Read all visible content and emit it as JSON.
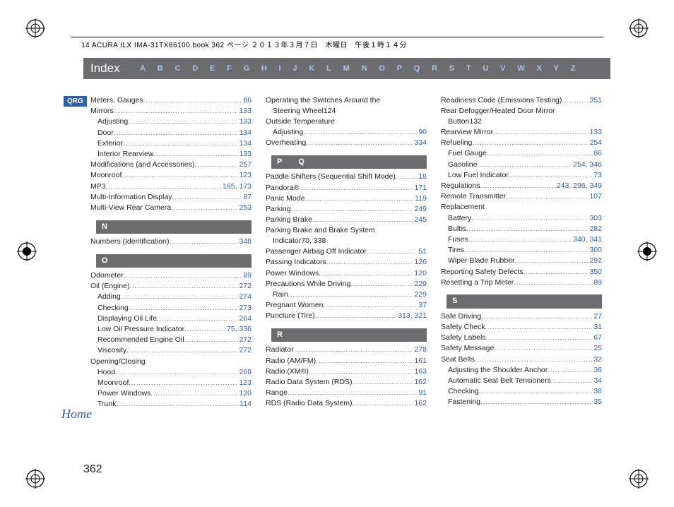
{
  "header": "14 ACURA ILX IMA-31TX86100.book  362 ページ  ２０１３年３月７日　木曜日　午後１時１４分",
  "qrg": "QRG",
  "home": "Home",
  "title": "Index",
  "alphabet": [
    "A",
    "B",
    "C",
    "D",
    "E",
    "F",
    "G",
    "H",
    "I",
    "J",
    "K",
    "L",
    "M",
    "N",
    "O",
    "P",
    "Q",
    "R",
    "S",
    "T",
    "U",
    "V",
    "W",
    "X",
    "Y",
    "Z"
  ],
  "page_number": "362",
  "columns": [
    {
      "items": [
        {
          "type": "entry",
          "label": "Meters, Gauges",
          "pages": "86"
        },
        {
          "type": "entry",
          "label": "Mirrors",
          "pages": "133"
        },
        {
          "type": "entry",
          "sub": true,
          "label": "Adjusting",
          "pages": "133"
        },
        {
          "type": "entry",
          "sub": true,
          "label": "Door",
          "pages": "134"
        },
        {
          "type": "entry",
          "sub": true,
          "label": "Exterior",
          "pages": "134"
        },
        {
          "type": "entry",
          "sub": true,
          "label": "Interior Rearview",
          "pages": "133"
        },
        {
          "type": "entry",
          "label": "Modifications (and Accessories)",
          "pages": "257"
        },
        {
          "type": "entry",
          "label": "Moonroof",
          "pages": "123"
        },
        {
          "type": "entry",
          "label": "MP3",
          "pages": "165, 173"
        },
        {
          "type": "entry",
          "label": "Multi-Information Display",
          "pages": "87"
        },
        {
          "type": "entry",
          "label": "Multi-View Rear Camera",
          "pages": "253"
        },
        {
          "type": "section",
          "label": "N"
        },
        {
          "type": "entry",
          "label": "Numbers (Identification)",
          "pages": "348"
        },
        {
          "type": "section",
          "label": "O"
        },
        {
          "type": "entry",
          "label": "Odometer",
          "pages": "89"
        },
        {
          "type": "entry",
          "label": "Oil (Engine)",
          "pages": "272"
        },
        {
          "type": "entry",
          "sub": true,
          "label": "Adding",
          "pages": "274"
        },
        {
          "type": "entry",
          "sub": true,
          "label": "Checking",
          "pages": "273"
        },
        {
          "type": "entry",
          "sub": true,
          "label": "Displaying Oil Life",
          "pages": "264"
        },
        {
          "type": "entry",
          "sub": true,
          "label": "Low Oil Pressure Indicator",
          "pages": "75, 336"
        },
        {
          "type": "entry",
          "sub": true,
          "label": "Recommended Engine Oil",
          "pages": "272"
        },
        {
          "type": "entry",
          "sub": true,
          "label": "Viscosity",
          "pages": "272"
        },
        {
          "type": "plain",
          "label": "Opening/Closing"
        },
        {
          "type": "entry",
          "sub": true,
          "label": "Hood",
          "pages": "269"
        },
        {
          "type": "entry",
          "sub": true,
          "label": "Moonroof",
          "pages": "123"
        },
        {
          "type": "entry",
          "sub": true,
          "label": "Power Windows",
          "pages": "120"
        },
        {
          "type": "entry",
          "sub": true,
          "label": "Trunk",
          "pages": "114"
        }
      ]
    },
    {
      "items": [
        {
          "type": "multiline",
          "first": "Operating the Switches Around the",
          "cont": "Steering Wheel",
          "pages": "124"
        },
        {
          "type": "plain",
          "label": "Outside Temperature"
        },
        {
          "type": "entry",
          "sub": true,
          "label": "Adjusting",
          "pages": "90"
        },
        {
          "type": "entry",
          "label": "Overheating",
          "pages": "334"
        },
        {
          "type": "section",
          "label": "P   Q"
        },
        {
          "type": "entry",
          "label": "Paddle Shifters (Sequential Shift Mode)",
          "pages": "18"
        },
        {
          "type": "entry",
          "label": "Pandora®",
          "pages": "171"
        },
        {
          "type": "entry",
          "label": "Panic Mode",
          "pages": "119"
        },
        {
          "type": "entry",
          "label": "Parking",
          "pages": "249"
        },
        {
          "type": "entry",
          "label": "Parking Brake",
          "pages": "245"
        },
        {
          "type": "multiline",
          "first": "Parking Brake and Brake System",
          "cont": "Indicator",
          "pages": "70, 338"
        },
        {
          "type": "entry",
          "label": "Passenger Airbag Off Indicator",
          "pages": "51"
        },
        {
          "type": "entry",
          "label": "Passing Indicators",
          "pages": "126"
        },
        {
          "type": "entry",
          "label": "Power Windows",
          "pages": "120"
        },
        {
          "type": "entry",
          "label": "Precautions While Driving",
          "pages": "229"
        },
        {
          "type": "entry",
          "sub": true,
          "label": "Rain",
          "pages": "229"
        },
        {
          "type": "entry",
          "label": "Pregnant Women",
          "pages": "37"
        },
        {
          "type": "entry",
          "label": "Puncture (Tire)",
          "pages": "313, 321"
        },
        {
          "type": "section",
          "label": "R"
        },
        {
          "type": "entry",
          "label": "Radiator",
          "pages": "278"
        },
        {
          "type": "entry",
          "label": "Radio (AM/FM)",
          "pages": "161"
        },
        {
          "type": "entry",
          "label": "Radio (XM®)",
          "pages": "163"
        },
        {
          "type": "entry",
          "label": "Radio Data System (RDS)",
          "pages": "162"
        },
        {
          "type": "entry",
          "label": "Range",
          "pages": "91"
        },
        {
          "type": "entry",
          "label": "RDS (Radio Data System)",
          "pages": "162"
        }
      ]
    },
    {
      "items": [
        {
          "type": "entry",
          "label": "Readiness Code (Emissions Testing)",
          "pages": "351"
        },
        {
          "type": "multiline",
          "first": "Rear Defogger/Heated Door Mirror",
          "cont": "Button",
          "pages": "132"
        },
        {
          "type": "entry",
          "label": "Rearview Mirror",
          "pages": "133"
        },
        {
          "type": "entry",
          "label": "Refueling",
          "pages": "254"
        },
        {
          "type": "entry",
          "sub": true,
          "label": "Fuel Gauge",
          "pages": "86"
        },
        {
          "type": "entry",
          "sub": true,
          "label": "Gasoline",
          "pages": "254, 346"
        },
        {
          "type": "entry",
          "sub": true,
          "label": "Low Fuel Indicator",
          "pages": "73"
        },
        {
          "type": "entry",
          "label": "Regulations",
          "pages": "243, 296, 349"
        },
        {
          "type": "entry",
          "label": "Remote Transmitter",
          "pages": "107"
        },
        {
          "type": "plain",
          "label": "Replacement"
        },
        {
          "type": "entry",
          "sub": true,
          "label": "Battery",
          "pages": "303"
        },
        {
          "type": "entry",
          "sub": true,
          "label": "Bulbs",
          "pages": "282"
        },
        {
          "type": "entry",
          "sub": true,
          "label": "Fuses",
          "pages": "340, 341"
        },
        {
          "type": "entry",
          "sub": true,
          "label": "Tires",
          "pages": "300"
        },
        {
          "type": "entry",
          "sub": true,
          "label": "Wiper Blade Rubber",
          "pages": "292"
        },
        {
          "type": "entry",
          "label": "Reporting Safety Defects",
          "pages": "350"
        },
        {
          "type": "entry",
          "label": "Resetting a Trip Meter",
          "pages": "89"
        },
        {
          "type": "section",
          "label": "S"
        },
        {
          "type": "entry",
          "label": "Safe Driving",
          "pages": "27"
        },
        {
          "type": "entry",
          "label": "Safety Check",
          "pages": "31"
        },
        {
          "type": "entry",
          "label": "Safety Labels",
          "pages": "67"
        },
        {
          "type": "entry",
          "label": "Safety Message",
          "pages": "25"
        },
        {
          "type": "entry",
          "label": "Seat Belts",
          "pages": "32"
        },
        {
          "type": "entry",
          "sub": true,
          "label": "Adjusting the Shoulder Anchor",
          "pages": "36"
        },
        {
          "type": "entry",
          "sub": true,
          "label": "Automatic Seat Belt Tensioners",
          "pages": "34"
        },
        {
          "type": "entry",
          "sub": true,
          "label": "Checking",
          "pages": "38"
        },
        {
          "type": "entry",
          "sub": true,
          "label": "Fastening",
          "pages": "35"
        }
      ]
    }
  ]
}
